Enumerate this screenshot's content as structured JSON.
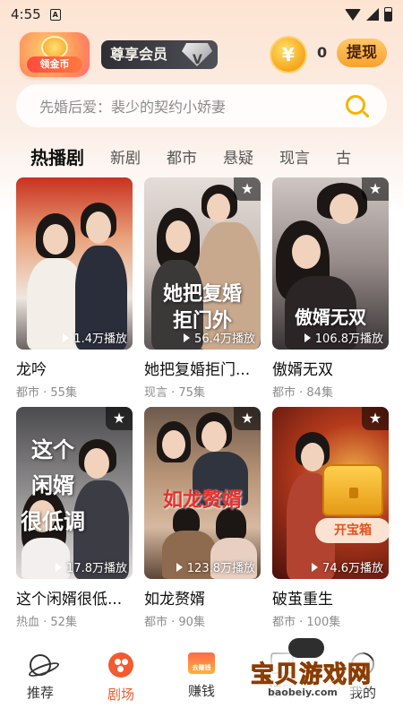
{
  "status_bar": {
    "time": "4:55",
    "sim_label": "A"
  },
  "header": {
    "gold_badge_label": "领金币",
    "vip_label": "尊享会员",
    "vip_diamond_letter": "V",
    "coin_symbol": "¥",
    "coin_count": "0",
    "withdraw_label": "提现"
  },
  "search": {
    "placeholder": "先婚后爱：裴少的契约小娇妻"
  },
  "tabs": [
    {
      "label": "热播剧",
      "active": true
    },
    {
      "label": "新剧"
    },
    {
      "label": "都市"
    },
    {
      "label": "悬疑"
    },
    {
      "label": "现言"
    },
    {
      "label": "古"
    }
  ],
  "cards": [
    {
      "title": "龙吟",
      "meta": "都市 · 55集",
      "plays": "1.4万播放",
      "overlay": "",
      "colors": [
        "#cf3b2a",
        "#f1e4da"
      ]
    },
    {
      "title": "她把复婚拒门...",
      "meta": "现言 · 75集",
      "plays": "56.4万播放",
      "overlay": "她把复婚\n拒门外",
      "colors": [
        "#d6c8c0",
        "#3e3a3c"
      ]
    },
    {
      "title": "傲婿无双",
      "meta": "都市 · 84集",
      "plays": "106.8万播放",
      "overlay": "傲婿无双",
      "colors": [
        "#bfb3b0",
        "#3b3538"
      ]
    },
    {
      "title": "这个闲婿很低...",
      "meta": "热血 · 52集",
      "plays": "17.8万播放",
      "overlay": "这个\n闲婿\n很低调",
      "colors": [
        "#6b6a6c",
        "#e7e2de"
      ]
    },
    {
      "title": "如龙赘婿",
      "meta": "都市 · 90集",
      "plays": "123.8万播放",
      "overlay": "如龙赘婿",
      "colors": [
        "#b08d6c",
        "#43302a"
      ]
    },
    {
      "title": "破茧重生",
      "meta": "都市 · 100集",
      "plays": "74.6万播放",
      "overlay": "",
      "colors": [
        "#7b1b16",
        "#c8532a"
      ]
    }
  ],
  "treasure": {
    "label": "开宝箱"
  },
  "bottom_nav": [
    {
      "label": "推荐",
      "icon": "planet-icon"
    },
    {
      "label": "剧场",
      "icon": "reel-icon",
      "active": true
    },
    {
      "label": "赚钱",
      "icon": "earn-icon",
      "badge": "去赚钱"
    },
    {
      "label": "追剧",
      "icon": "theater-icon"
    },
    {
      "label": "我的",
      "icon": "person-icon"
    }
  ],
  "watermark": {
    "text": "宝贝游戏网",
    "url": "baobeiy.com"
  },
  "colors": {
    "accent": "#f05a2c",
    "gold": "#f5b400"
  }
}
